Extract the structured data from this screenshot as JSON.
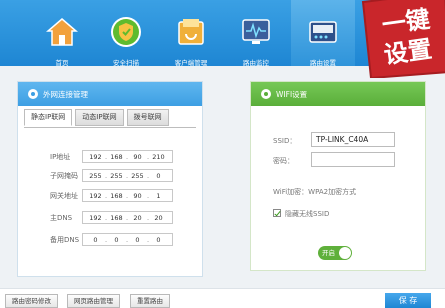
{
  "nav": {
    "items": [
      {
        "label": "首页",
        "icon": "home-icon"
      },
      {
        "label": "安全扫描",
        "icon": "shield-icon"
      },
      {
        "label": "客户端管理",
        "icon": "folder-icon"
      },
      {
        "label": "路由监控",
        "icon": "monitor-icon"
      },
      {
        "label": "路由设置",
        "icon": "router-settings-icon"
      }
    ],
    "active_index": 4
  },
  "ribbon": {
    "line1": "一键",
    "line2": "设置"
  },
  "wan_panel": {
    "title": "外网连接管理",
    "tabs": [
      "静态IP联网",
      "动态IP联网",
      "拨号联网"
    ],
    "active_tab": 0,
    "fields": [
      {
        "label": "IP地址",
        "octets": [
          "192",
          "168",
          "90",
          "210"
        ]
      },
      {
        "label": "子网掩码",
        "octets": [
          "255",
          "255",
          "255",
          "0"
        ]
      },
      {
        "label": "网关地址",
        "octets": [
          "192",
          "168",
          "90",
          "1"
        ]
      },
      {
        "label": "主DNS",
        "octets": [
          "192",
          "168",
          "20",
          "20"
        ]
      },
      {
        "label": "备用DNS",
        "octets": [
          "0",
          "0",
          "0",
          "0"
        ]
      }
    ]
  },
  "wifi_panel": {
    "title": "WIFI设置",
    "ssid_label": "SSID：",
    "ssid_value": "TP-LINK_C40A",
    "password_label": "密码：",
    "password_value": "",
    "encryption_text": "WiFi加密：WPA2加密方式",
    "hide_ssid_label": "隐藏无线SSID",
    "hide_ssid_checked": true,
    "toggle_label": "开启"
  },
  "bottom": {
    "buttons": [
      "路由密码修改",
      "网页路由管理",
      "重置路由"
    ],
    "save_label": "保 存"
  },
  "colors": {
    "nav_blue": "#1e86d3",
    "ribbon_red": "#c9262b",
    "wifi_green": "#5aae3a"
  }
}
